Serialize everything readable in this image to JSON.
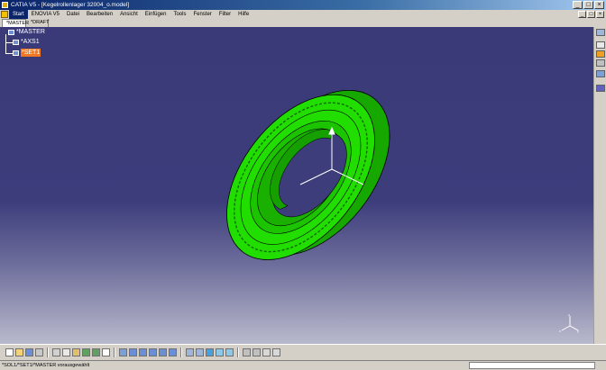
{
  "window": {
    "title": "CATIA V5 - [Kegelrollenlager 32004_o.model]",
    "controls": [
      "_",
      "□",
      "×"
    ]
  },
  "menubar": {
    "items": [
      "Start",
      "ENOVIA V5",
      "Datei",
      "Bearbeiten",
      "Ansicht",
      "Einfügen",
      "Tools",
      "Fenster",
      "Filter",
      "Hilfe"
    ],
    "active_item": "Start"
  },
  "tabs": [
    {
      "label": "*MASTER",
      "active": true
    },
    {
      "label": "*DRAFT",
      "active": false
    }
  ],
  "tree": {
    "root": "*MASTER",
    "children": [
      {
        "label": "*AXS1",
        "selected": false
      },
      {
        "label": "*SET1",
        "selected": true
      }
    ]
  },
  "viewport": {
    "background_top": "#3a3a78",
    "background_bottom": "#b9b9cc",
    "part_color": "#22dd00",
    "part_shade": "#17a800",
    "axis_labels": {
      "x": "x",
      "y": "y",
      "z": "z"
    }
  },
  "icons": {
    "right_toolbar": [
      "select-icon",
      "sketch-icon",
      "pad-icon",
      "hole-icon",
      "axis-icon",
      "list-icon"
    ],
    "bottom_toolbar": [
      "new-icon",
      "open-icon",
      "save-icon",
      "print-icon",
      "cut-icon",
      "copy-icon",
      "paste-icon",
      "undo-icon",
      "redo-icon",
      "whats-this-icon",
      "fly-icon",
      "fit-all-icon",
      "pan-icon",
      "rotate-icon",
      "zoom-in-icon",
      "zoom-out-icon",
      "normal-view-icon",
      "iso-view-icon",
      "shading-icon",
      "hide-show-icon",
      "swap-space-icon",
      "measure-icon",
      "analysis-icon",
      "snap-icon",
      "grid-icon"
    ]
  },
  "status": {
    "message": "*SOL1/*SET1/*MASTER vorausgewählt",
    "command_value": ""
  }
}
